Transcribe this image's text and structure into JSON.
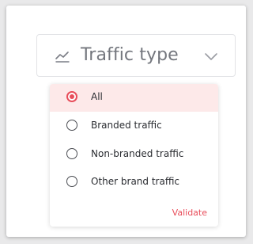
{
  "filter": {
    "title": "Traffic type",
    "icon": "trending-line-icon",
    "dropdown_icon": "chevron-down-icon",
    "accent_color": "#e84d5a"
  },
  "options": [
    {
      "label": "All",
      "selected": true
    },
    {
      "label": "Branded traffic",
      "selected": false
    },
    {
      "label": "Non-branded traffic",
      "selected": false
    },
    {
      "label": "Other brand traffic",
      "selected": false
    }
  ],
  "actions": {
    "validate_label": "Validate"
  }
}
